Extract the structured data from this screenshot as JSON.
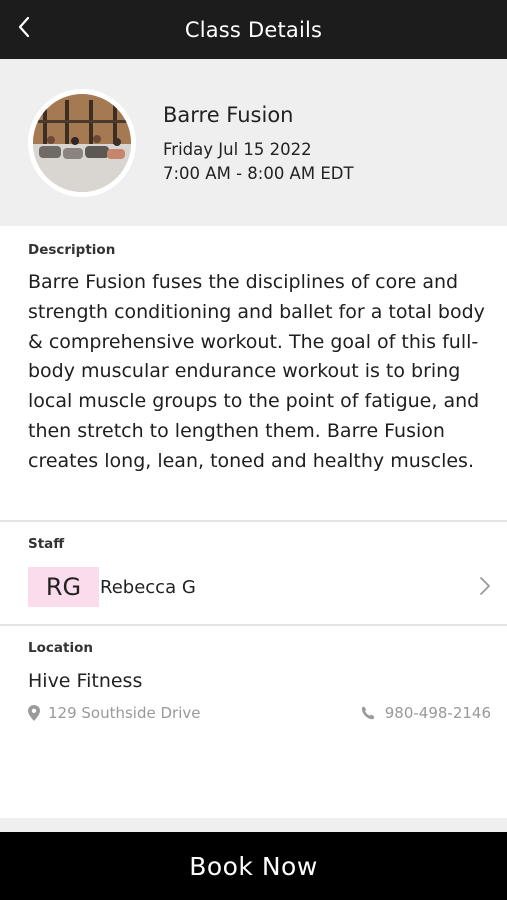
{
  "header": {
    "title": "Class Details",
    "back_icon": "chevron-left-icon"
  },
  "class": {
    "name": "Barre Fusion",
    "date": "Friday Jul 15 2022",
    "time": "7:00 AM - 8:00 AM EDT"
  },
  "description": {
    "label": "Description",
    "text": "Barre Fusion fuses the disciplines of core and strength conditioning and ballet for a total body & comprehensive workout. The goal of this full-body muscular endurance workout is to bring local muscle groups to the point of fatigue, and then stretch to lengthen them. Barre Fusion creates long, lean, toned and healthy muscles."
  },
  "staff": {
    "label": "Staff",
    "initials": "RG",
    "name": "Rebecca G",
    "initials_bg": "#fbdcec"
  },
  "location": {
    "label": "Location",
    "name": "Hive Fitness",
    "address": "129 Southside Drive",
    "phone": "980-498-2146"
  },
  "footer": {
    "book_label": "Book Now"
  },
  "colors": {
    "topbar": "#1c1c1c",
    "hero_bg": "#efefef",
    "muted_text": "#999999",
    "button_bg": "#000000"
  }
}
